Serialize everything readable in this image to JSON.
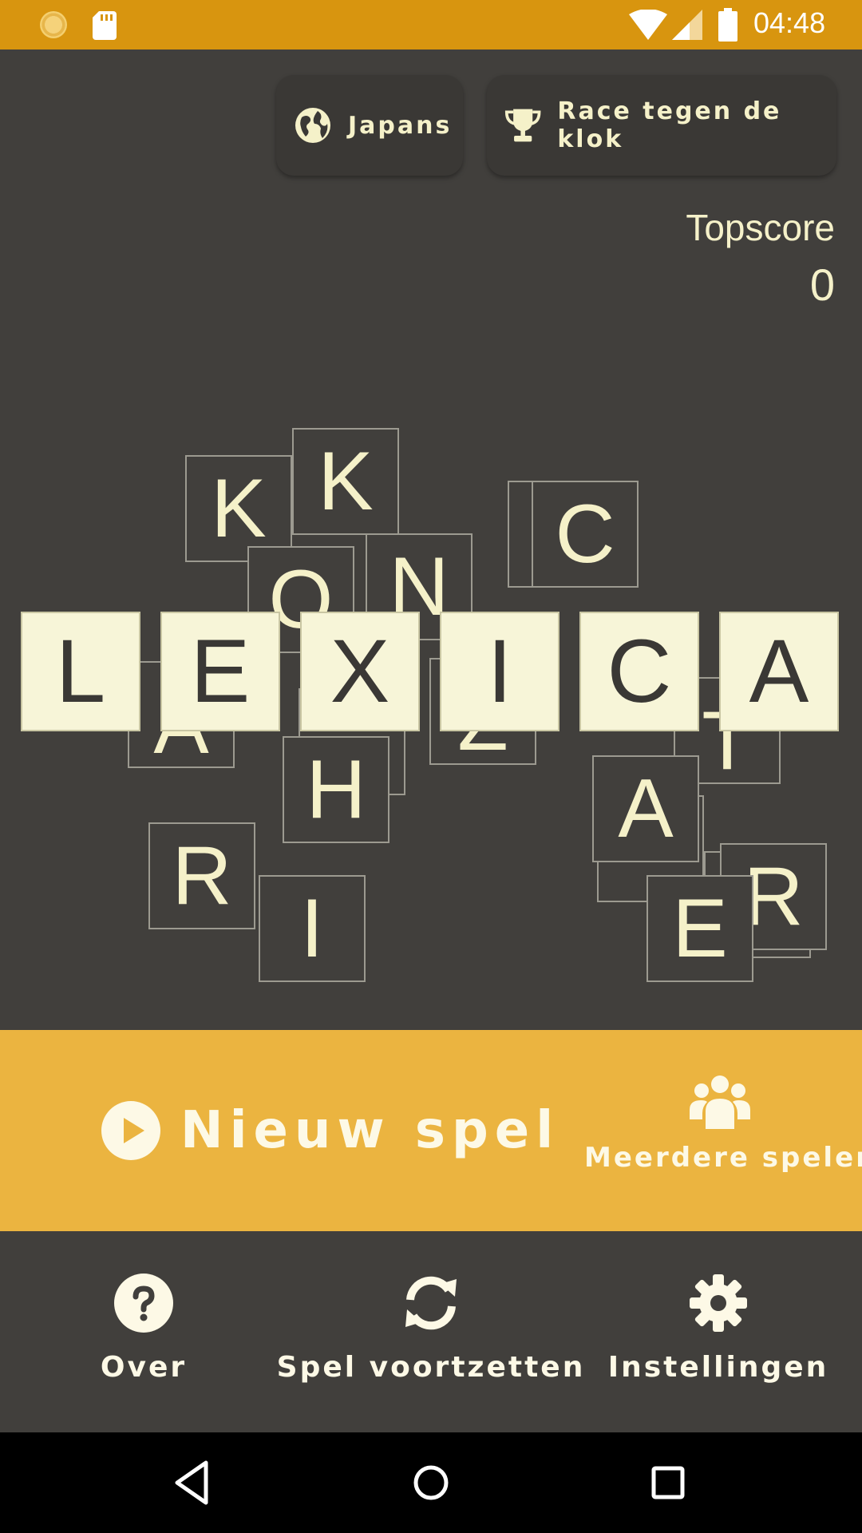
{
  "status_bar": {
    "time": "04:48",
    "color": "#d8950f"
  },
  "top": {
    "language": {
      "label": "Japans",
      "icon": "globe-icon"
    },
    "mode": {
      "label": "Race tegen de klok",
      "icon": "trophy-icon"
    }
  },
  "topscore": {
    "label": "Topscore",
    "value": "0"
  },
  "logo": {
    "letters": [
      "L",
      "E",
      "X",
      "I",
      "C",
      "A"
    ]
  },
  "scattered_tiles": [
    "K",
    "K",
    "O",
    "N",
    "C",
    "A",
    "Z",
    "H",
    "T",
    "A",
    "R",
    "I",
    "E",
    "R"
  ],
  "actions": {
    "new_game": {
      "label": "Nieuw spel",
      "icon": "play-icon"
    },
    "multiplayer": {
      "label": "Meerdere spelers",
      "icon": "group-icon"
    }
  },
  "bottom": {
    "about": {
      "label": "Over",
      "icon": "help-icon"
    },
    "continue": {
      "label": "Spel voortzetten",
      "icon": "refresh-icon"
    },
    "settings": {
      "label": "Instellingen",
      "icon": "gear-icon"
    }
  },
  "colors": {
    "background": "#413f3c",
    "accent": "#ebb440",
    "tile_cream": "#f7f5d8",
    "text": "#f5f1c9"
  }
}
